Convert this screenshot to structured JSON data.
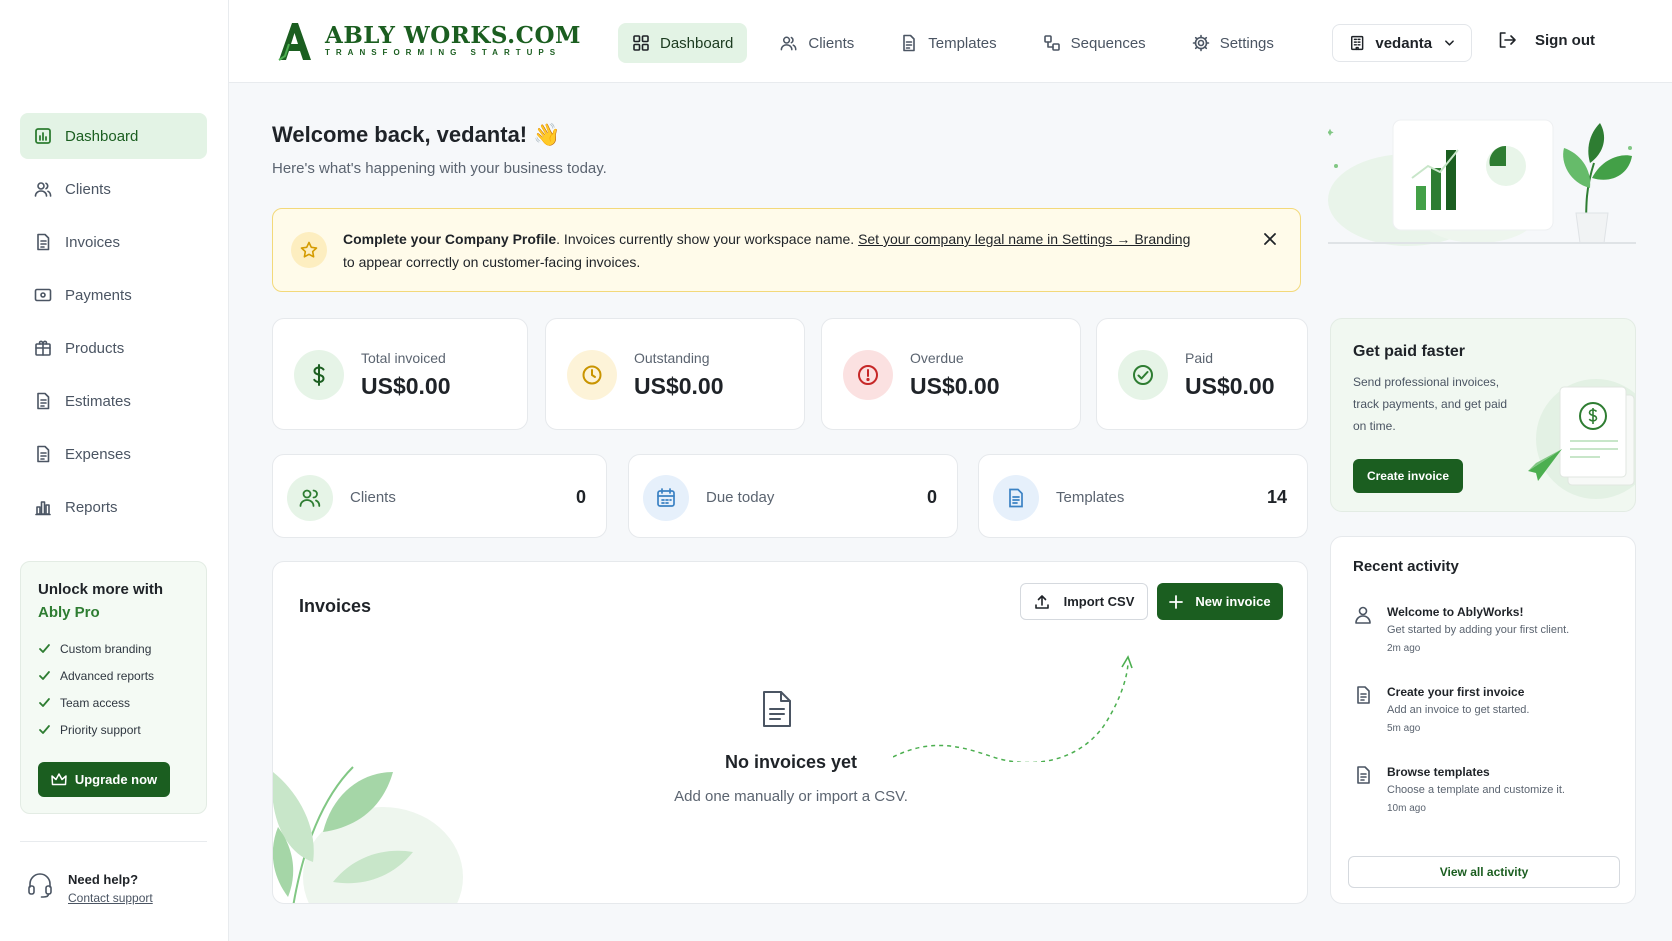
{
  "brand": {
    "name": "ABLY WORKS.COM",
    "tagline": "TRANSFORMING STARTUPS",
    "color": "#1b5e20"
  },
  "topnav": {
    "tabs": [
      {
        "label": "Dashboard",
        "icon": "grid-icon",
        "active": true
      },
      {
        "label": "Clients",
        "icon": "users-icon"
      },
      {
        "label": "Templates",
        "icon": "document-icon"
      },
      {
        "label": "Sequences",
        "icon": "sequence-icon"
      },
      {
        "label": "Settings",
        "icon": "gear-icon"
      }
    ],
    "workspace": "vedanta",
    "signout": "Sign out"
  },
  "sidebar": {
    "items": [
      {
        "label": "Dashboard",
        "icon": "dashboard-icon",
        "active": true
      },
      {
        "label": "Clients",
        "icon": "users-icon"
      },
      {
        "label": "Invoices",
        "icon": "invoice-icon"
      },
      {
        "label": "Payments",
        "icon": "payment-icon"
      },
      {
        "label": "Products",
        "icon": "box-icon"
      },
      {
        "label": "Estimates",
        "icon": "estimate-icon"
      },
      {
        "label": "Expenses",
        "icon": "expense-icon"
      },
      {
        "label": "Reports",
        "icon": "reports-icon"
      }
    ],
    "pro": {
      "title_prefix": "Unlock more with",
      "title_brand": "Ably Pro",
      "features": [
        "Custom branding",
        "Advanced reports",
        "Team access",
        "Priority support"
      ],
      "button": "Upgrade now"
    },
    "help": {
      "title": "Need help?",
      "link": "Contact support"
    }
  },
  "welcome": {
    "title": "Welcome back, vedanta! 👋",
    "subtitle": "Here's what's happening with your business today."
  },
  "alert": {
    "bold": "Complete your Company Profile",
    "text": ". Invoices currently show your workspace name. ",
    "link": "Set your company legal name in Settings → Branding",
    "tail": "to appear correctly on customer-facing invoices."
  },
  "stats": [
    {
      "label": "Total invoiced",
      "value": "US$0.00",
      "icon": "dollar-icon",
      "color": "#2e7d32",
      "bg": "#e6f4e7"
    },
    {
      "label": "Outstanding",
      "value": "US$0.00",
      "icon": "clock-icon",
      "color": "#c99400",
      "bg": "#fdf3d8"
    },
    {
      "label": "Overdue",
      "value": "US$0.00",
      "icon": "alert-icon",
      "color": "#c62828",
      "bg": "#fbe1e1"
    },
    {
      "label": "Paid",
      "value": "US$0.00",
      "icon": "check-circle-icon",
      "color": "#2e7d32",
      "bg": "#e6f4e7"
    }
  ],
  "mini_stats": [
    {
      "label": "Clients",
      "value": "0",
      "icon": "users-icon"
    },
    {
      "label": "Due today",
      "value": "0",
      "icon": "calendar-icon"
    },
    {
      "label": "Templates",
      "value": "14",
      "icon": "document-icon"
    }
  ],
  "invoices": {
    "title": "Invoices",
    "import_label": "Import CSV",
    "new_label": "New invoice",
    "empty_title": "No invoices yet",
    "empty_sub": "Add one manually or import a CSV."
  },
  "get_paid": {
    "title": "Get paid faster",
    "text": "Send professional invoices, track payments, and get paid on time.",
    "button": "Create invoice"
  },
  "activity": {
    "title": "Recent activity",
    "items": [
      {
        "title": "Welcome to AblyWorks!",
        "desc": "Get started by adding your first client.",
        "when": "2m ago",
        "icon": "user-icon"
      },
      {
        "title": "Create your first invoice",
        "desc": "Add an invoice to get started.",
        "when": "5m ago",
        "icon": "document-icon"
      },
      {
        "title": "Browse templates",
        "desc": "Choose a template and customize it.",
        "when": "10m ago",
        "icon": "document-icon"
      }
    ],
    "view_all": "View all activity"
  }
}
